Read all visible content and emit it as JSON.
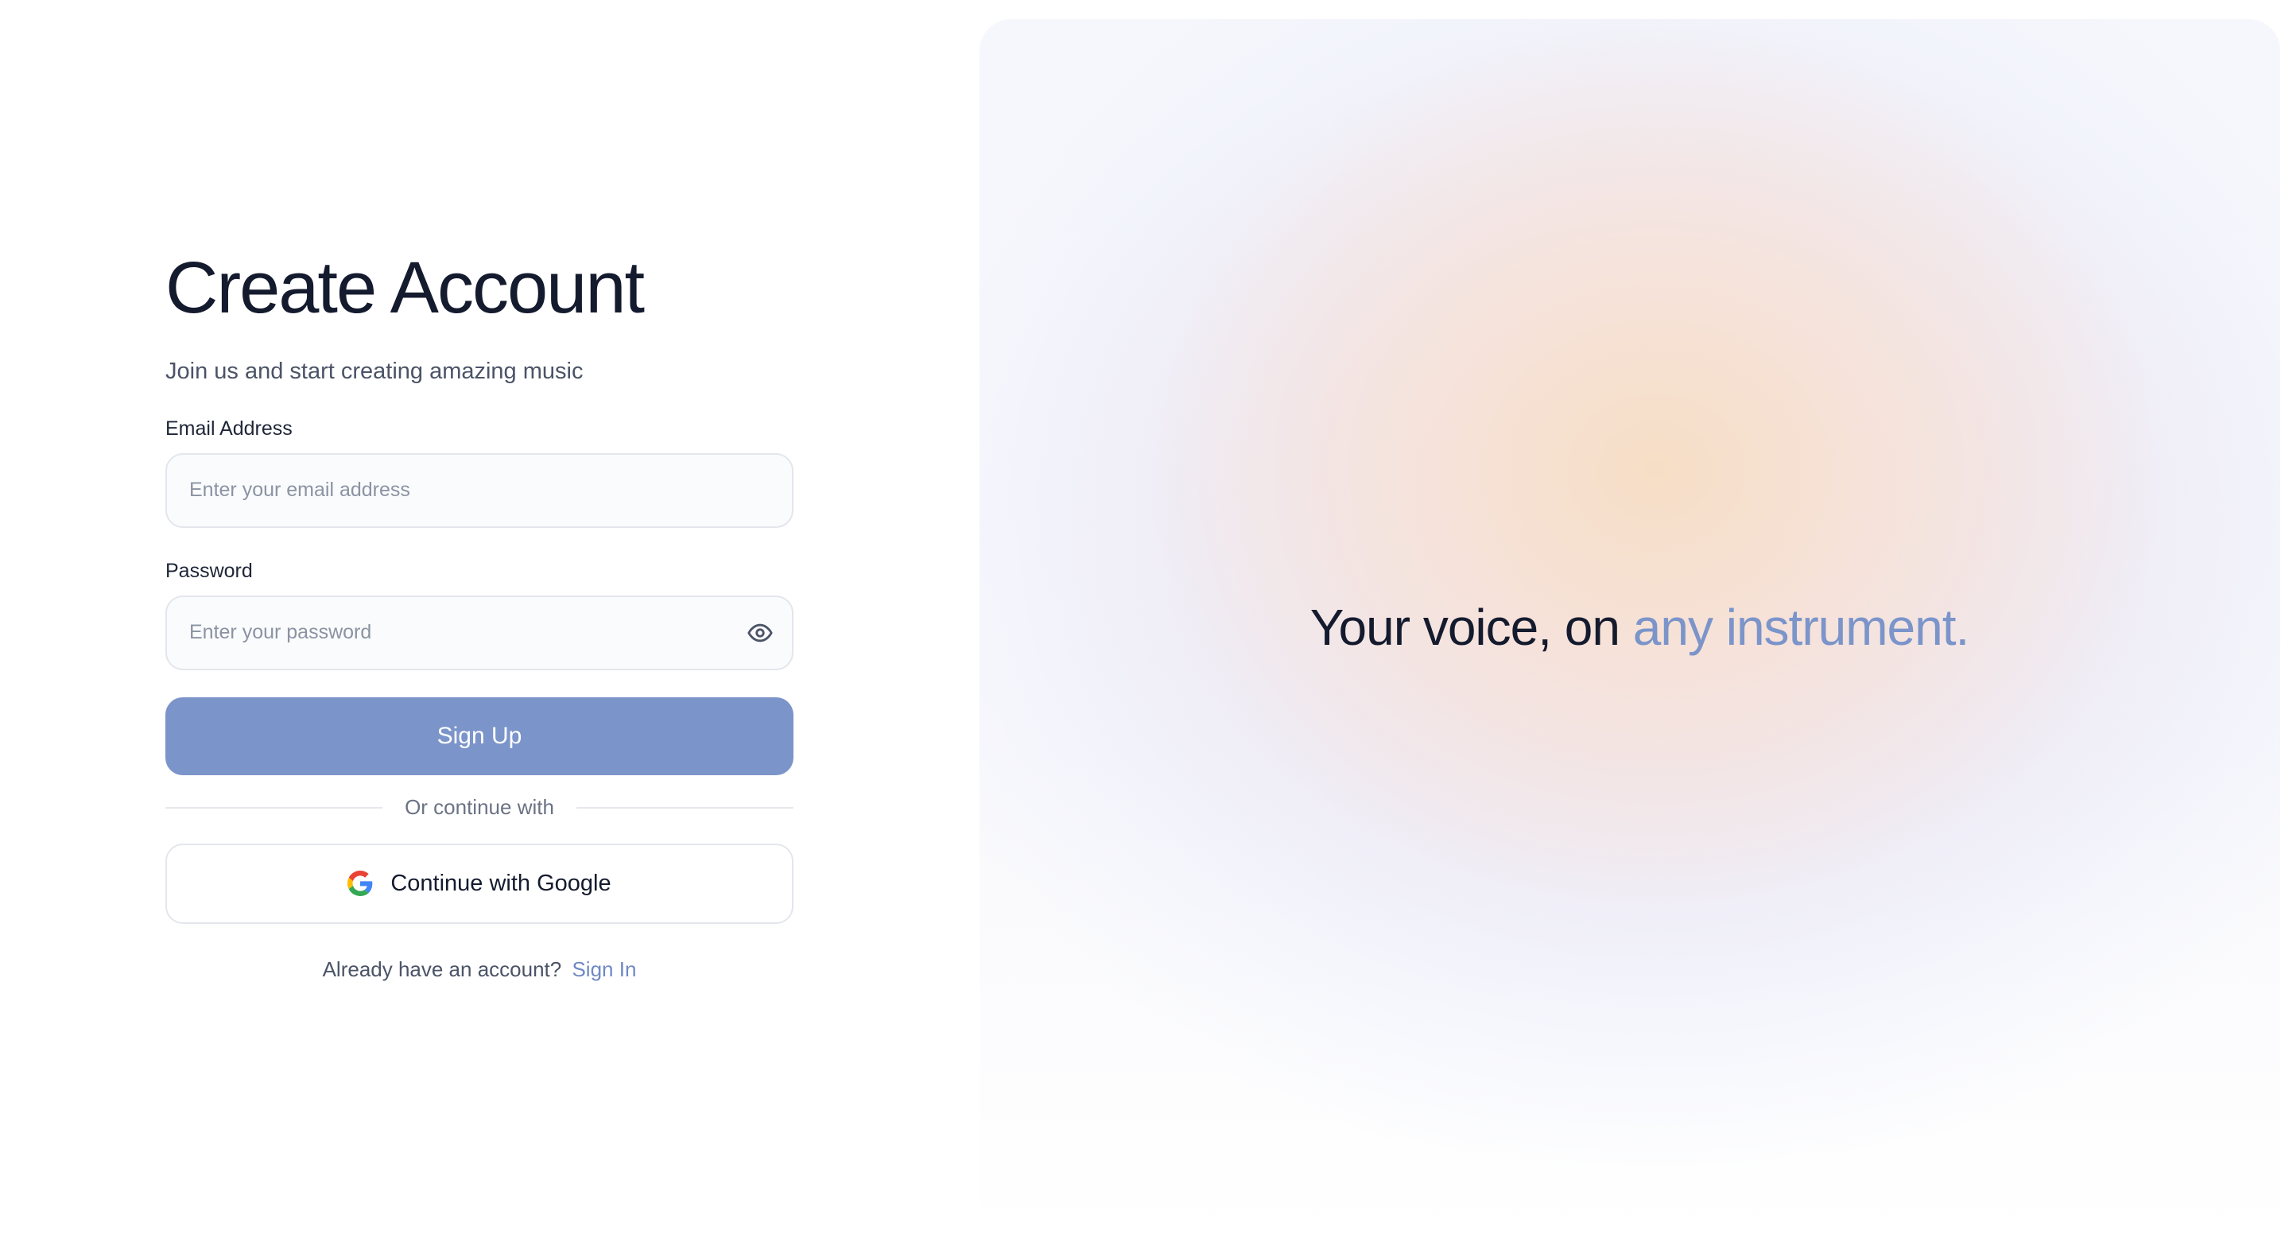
{
  "form": {
    "title": "Create Account",
    "subtitle": "Join us and start creating amazing music",
    "email_label": "Email Address",
    "email_placeholder": "Enter your email address",
    "email_value": "",
    "password_label": "Password",
    "password_placeholder": "Enter your password",
    "password_value": "",
    "password_toggle_icon": "eye-icon",
    "signup_label": "Sign Up",
    "divider_text": "Or continue with",
    "google_label": "Continue with Google",
    "google_icon": "google-icon",
    "signin_prompt": "Already have an account?",
    "signin_link": "Sign In"
  },
  "hero": {
    "tagline_main": "Your voice, on",
    "tagline_accent": "any instrument."
  },
  "colors": {
    "accent": "#7b94ca",
    "title_text": "#151b2e",
    "muted_text": "#4b5366",
    "border": "#e3e6ec",
    "link": "#6f88c4"
  }
}
